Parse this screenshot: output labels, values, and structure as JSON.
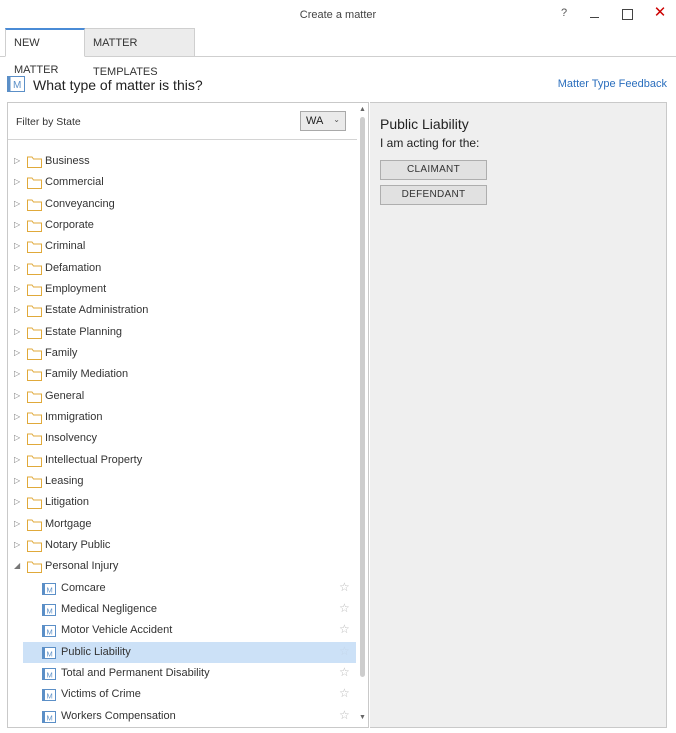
{
  "window": {
    "title": "Create a matter",
    "help_label": "?",
    "close_label": "✕"
  },
  "tabs": [
    {
      "label": "NEW MATTER",
      "active": true
    },
    {
      "label": "MATTER TEMPLATES",
      "active": false
    }
  ],
  "heading": {
    "text": "What type of matter is this?",
    "icon": "matter-type-icon"
  },
  "feedback_link": "Matter Type Feedback",
  "filter": {
    "label": "Filter by State",
    "value": "WA"
  },
  "tree": {
    "folders": [
      "Business",
      "Commercial",
      "Conveyancing",
      "Corporate",
      "Criminal",
      "Defamation",
      "Employment",
      "Estate Administration",
      "Estate Planning",
      "Family",
      "Family Mediation",
      "General",
      "Immigration",
      "Insolvency",
      "Intellectual Property",
      "Leasing",
      "Litigation",
      "Mortgage",
      "Notary Public"
    ],
    "expanded_folder": "Personal Injury",
    "children": [
      {
        "label": "Comcare",
        "selected": false
      },
      {
        "label": "Medical Negligence",
        "selected": false
      },
      {
        "label": "Motor Vehicle Accident",
        "selected": false
      },
      {
        "label": "Public Liability",
        "selected": true
      },
      {
        "label": "Total and Permanent Disability",
        "selected": false
      },
      {
        "label": "Victims of Crime",
        "selected": false
      },
      {
        "label": "Workers Compensation",
        "selected": false
      }
    ]
  },
  "detail": {
    "title": "Public Liability",
    "subtitle": "I am acting for the:",
    "buttons": [
      "CLAIMANT",
      "DEFENDANT"
    ]
  },
  "colors": {
    "accent": "#4a8bd6",
    "link": "#2a6ebd",
    "selection": "#cce1f7",
    "folder": "#e8b64c"
  }
}
